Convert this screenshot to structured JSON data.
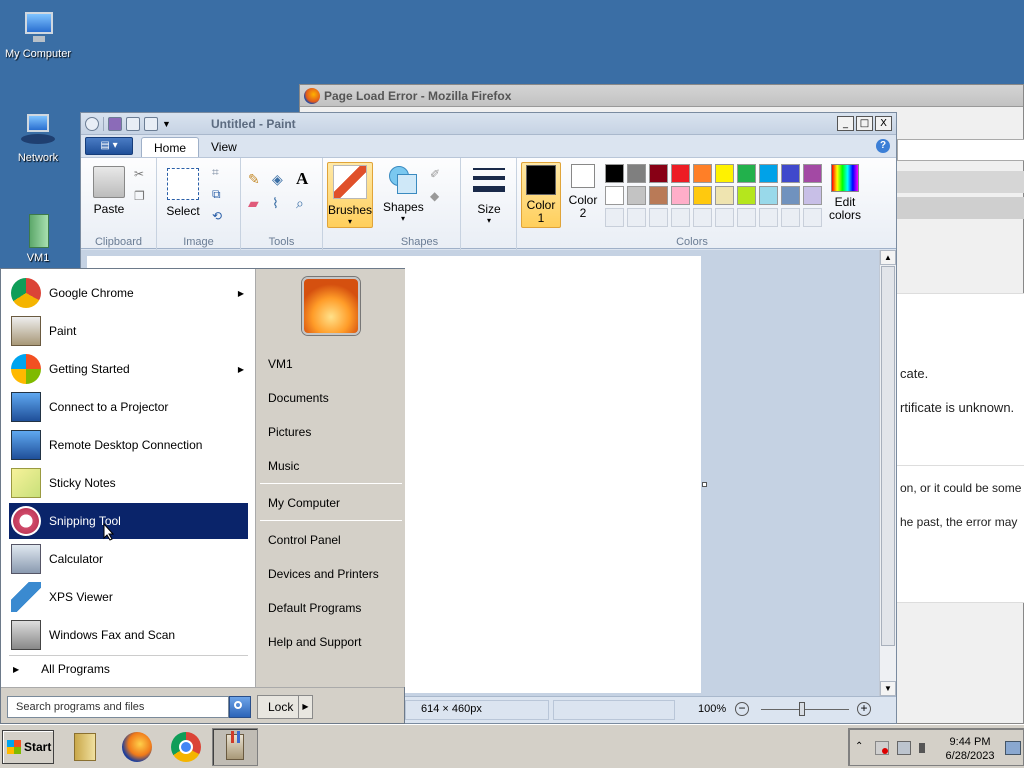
{
  "desktop": {
    "icons": [
      {
        "label": "My Computer"
      },
      {
        "label": "Network"
      },
      {
        "label": "VM1"
      }
    ]
  },
  "firefox": {
    "title": "Page Load Error - Mozilla Firefox",
    "text_lines": [
      "cate.",
      "rtificate is unknown.",
      "on, or it could be some",
      "he past, the error may"
    ]
  },
  "paint": {
    "title": "Untitled - Paint",
    "window_buttons": {
      "minimize": "_",
      "maximize": "□",
      "close": "X"
    },
    "tabs": [
      "Home",
      "View"
    ],
    "groups": {
      "clipboard": {
        "label": "Clipboard",
        "paste": "Paste"
      },
      "image": {
        "label": "Image",
        "select": "Select"
      },
      "tools": {
        "label": "Tools"
      },
      "brushes": {
        "label": "Brushes"
      },
      "shapes": {
        "label": "Shapes",
        "shapes_btn": "Shapes"
      },
      "size": {
        "label": "Size"
      },
      "colors": {
        "label": "Colors",
        "color1": "Color 1",
        "color2": "Color 2",
        "edit": "Edit colors",
        "palette_row1": [
          "#000000",
          "#7f7f7f",
          "#880015",
          "#ed1c24",
          "#ff7f27",
          "#fff200",
          "#22b14c",
          "#00a2e8",
          "#3f48cc",
          "#a349a4"
        ],
        "palette_row2": [
          "#ffffff",
          "#c3c3c3",
          "#b97a57",
          "#ffaec9",
          "#ffc90e",
          "#efe4b0",
          "#b5e61d",
          "#99d9ea",
          "#7092be",
          "#c8bfe7"
        ]
      }
    },
    "status": {
      "size": "614 × 460px",
      "zoom": "100%"
    }
  },
  "start_menu": {
    "programs": [
      {
        "label": "Google Chrome",
        "submenu": true,
        "icon": "chrome-icon"
      },
      {
        "label": "Paint",
        "submenu": false,
        "icon": "paint-icon"
      },
      {
        "label": "Getting Started",
        "submenu": true,
        "icon": "getting-started-icon"
      },
      {
        "label": "Connect to a Projector",
        "submenu": false,
        "icon": "projector-icon"
      },
      {
        "label": "Remote Desktop Connection",
        "submenu": false,
        "icon": "remote-desktop-icon"
      },
      {
        "label": "Sticky Notes",
        "submenu": false,
        "icon": "sticky-notes-icon"
      },
      {
        "label": "Snipping Tool",
        "submenu": false,
        "icon": "snipping-tool-icon"
      },
      {
        "label": "Calculator",
        "submenu": false,
        "icon": "calculator-icon"
      },
      {
        "label": "XPS Viewer",
        "submenu": false,
        "icon": "xps-viewer-icon"
      },
      {
        "label": "Windows Fax and Scan",
        "submenu": false,
        "icon": "fax-scan-icon"
      }
    ],
    "all_programs": "All Programs",
    "right_items": [
      "VM1",
      "Documents",
      "Pictures",
      "Music",
      "My Computer",
      "Control Panel",
      "Devices and Printers",
      "Default Programs",
      "Help and Support"
    ],
    "search_placeholder": "Search programs and files",
    "lock_label": "Lock"
  },
  "taskbar": {
    "start_label": "Start",
    "clock_time": "9:44 PM",
    "clock_date": "6/28/2023"
  }
}
